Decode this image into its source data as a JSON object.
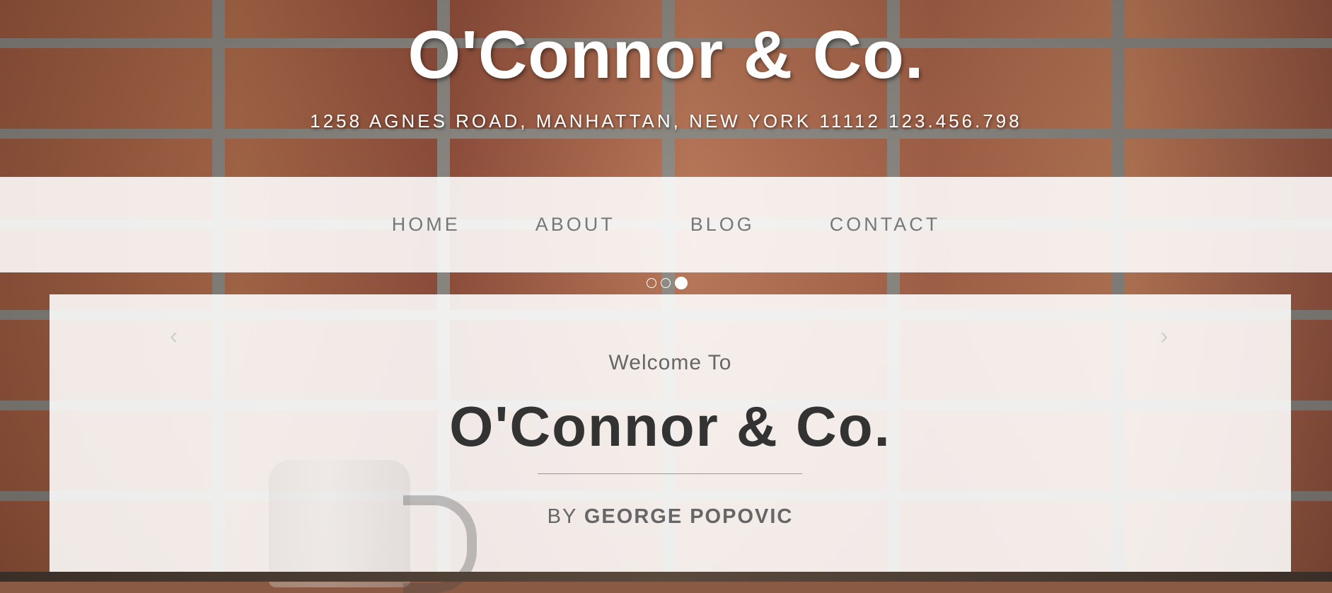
{
  "header": {
    "site_title": "O'Connor & Co.",
    "address": "1258 AGNES ROAD, MANHATTAN, NEW YORK 11112 123.456.798"
  },
  "nav": {
    "items": [
      {
        "label": "HOME"
      },
      {
        "label": "ABOUT"
      },
      {
        "label": "BLOG"
      },
      {
        "label": "CONTACT"
      }
    ]
  },
  "carousel": {
    "slide_count": 3,
    "active_index": 2,
    "prev_glyph": "‹",
    "next_glyph": "›"
  },
  "welcome": {
    "intro": "Welcome To",
    "title": "O'Connor & Co.",
    "by_prefix": "BY",
    "author": "GEORGE POPOVIC"
  },
  "icons": {
    "prev": "chevron-left-icon",
    "next": "chevron-right-icon"
  },
  "colors": {
    "title": "#ffffff",
    "nav_text": "#777777",
    "heading_dark": "#333333",
    "muted_text": "#666666"
  }
}
